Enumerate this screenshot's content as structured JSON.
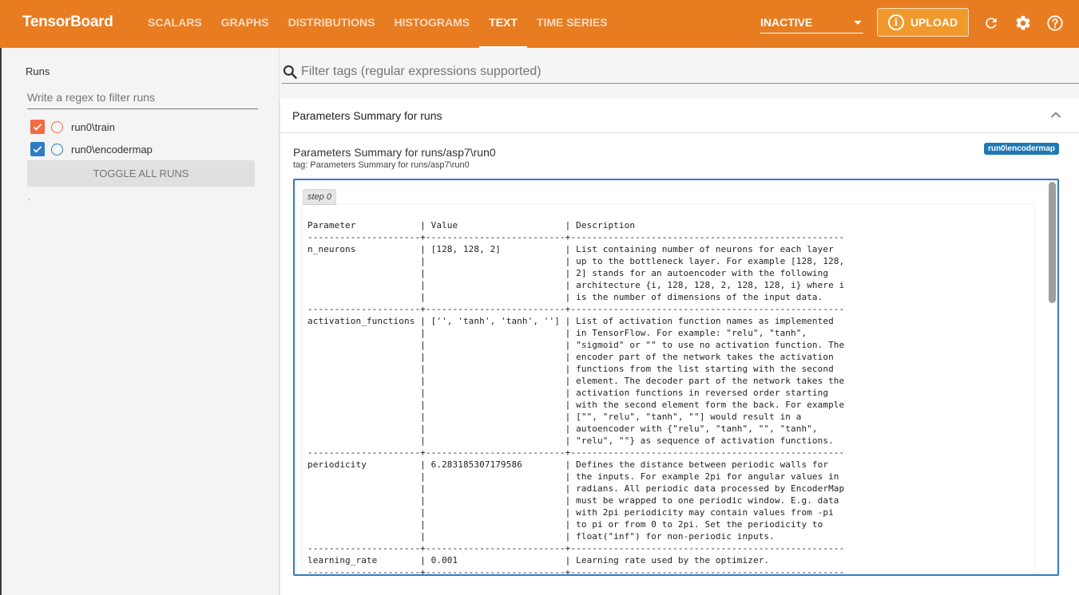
{
  "header": {
    "brand": "TensorBoard",
    "tabs": [
      {
        "label": "SCALARS",
        "active": false
      },
      {
        "label": "GRAPHS",
        "active": false
      },
      {
        "label": "DISTRIBUTIONS",
        "active": false
      },
      {
        "label": "HISTOGRAMS",
        "active": false
      },
      {
        "label": "TEXT",
        "active": true
      },
      {
        "label": "TIME SERIES",
        "active": false
      }
    ],
    "run_selector": "INACTIVE",
    "upload_label": "UPLOAD",
    "icons": [
      "refresh-icon",
      "settings-icon",
      "help-icon"
    ],
    "accent_color": "#e87c21"
  },
  "sidebar": {
    "title": "Runs",
    "filter_placeholder": "Write a regex to filter runs",
    "runs": [
      {
        "label": "run0\\train",
        "checked": true,
        "color": "#f26b43"
      },
      {
        "label": "run0\\encodermap",
        "checked": true,
        "color": "#2f7cc4"
      }
    ],
    "toggle_all_label": "TOGGLE ALL RUNS",
    "footer": "."
  },
  "main": {
    "tag_filter_placeholder": "Filter tags (regular expressions supported)",
    "card": {
      "title": "Parameters Summary for runs",
      "entry_title": "Parameters Summary for runs/asp7\\run0",
      "entry_tag": "tag: Parameters Summary for runs/asp7\\run0",
      "run_chip": "run0\\encodermap",
      "step_label": "step 0",
      "table": {
        "headers": [
          "Parameter",
          "Value",
          "Description"
        ],
        "rows": [
          {
            "param": "n_neurons",
            "value": "[128, 128, 2]",
            "description": [
              "List containing number of neurons for each layer",
              "up to the bottleneck layer. For example [128, 128,",
              "2] stands for an autoencoder with the following",
              "architecture {i, 128, 128, 2, 128, 128, i} where i",
              "is the number of dimensions of the input data."
            ]
          },
          {
            "param": "activation_functions",
            "value": "['', 'tanh', 'tanh', '']",
            "description": [
              "List of activation function names as implemented",
              "in TensorFlow. For example: \"relu\", \"tanh\",",
              "\"sigmoid\" or \"\" to use no activation function. The",
              "encoder part of the network takes the activation",
              "functions from the list starting with the second",
              "element. The decoder part of the network takes the",
              "activation functions in reversed order starting",
              "with the second element form the back. For example",
              "[\"\", \"relu\", \"tanh\", \"\"] would result in a",
              "autoencoder with {\"relu\", \"tanh\", \"\", \"tanh\",",
              "\"relu\", \"\"} as sequence of activation functions."
            ]
          },
          {
            "param": "periodicity",
            "value": "6.283185307179586",
            "description": [
              "Defines the distance between periodic walls for",
              "the inputs. For example 2pi for angular values in",
              "radians. All periodic data processed by EncoderMap",
              "must be wrapped to one periodic window. E.g. data",
              "with 2pi periodicity may contain values from -pi",
              "to pi or from 0 to 2pi. Set the periodicity to",
              "float(\"inf\") for non-periodic inputs."
            ]
          },
          {
            "param": "learning_rate",
            "value": "0.001",
            "description": [
              "Learning rate used by the optimizer."
            ]
          }
        ]
      }
    }
  }
}
